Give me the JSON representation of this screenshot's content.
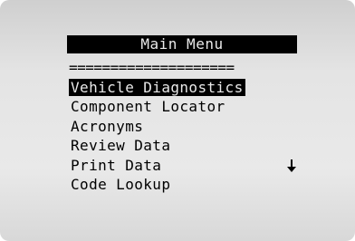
{
  "screen": {
    "title": "Main Menu",
    "separator": "===================="
  },
  "menu": {
    "items": [
      {
        "label": "Vehicle Diagnostics",
        "selected": true
      },
      {
        "label": "Component Locator"
      },
      {
        "label": "Acronyms"
      },
      {
        "label": "Review Data"
      },
      {
        "label": "Print Data"
      },
      {
        "label": "Code Lookup"
      }
    ],
    "scroll_indicator": "down-arrow-icon"
  },
  "colors": {
    "screen_bg": "#e9e9e9",
    "text": "#000000",
    "highlight_bg": "#000000",
    "highlight_text": "#e9e9e9"
  }
}
